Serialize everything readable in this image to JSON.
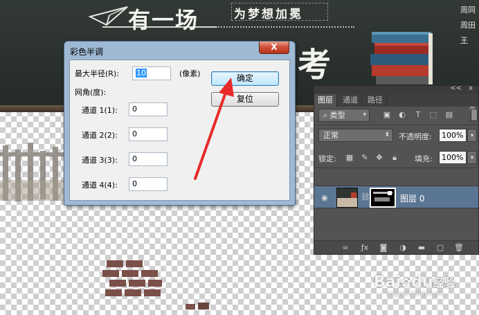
{
  "background": {
    "title_main": "有一场",
    "title_sub": "为梦想加冕",
    "title_big": "考",
    "right_side_text": "周同周田王"
  },
  "dialog": {
    "title": "彩色半调",
    "close_label": "X",
    "max_radius_label": "最大半径(R):",
    "max_radius_value": "10",
    "max_radius_unit": "(像素)",
    "screen_angles_label": "网角(度):",
    "channels": [
      {
        "label": "通道 1(1):",
        "value": "0"
      },
      {
        "label": "通道 2(2):",
        "value": "0"
      },
      {
        "label": "通道 3(3):",
        "value": "0"
      },
      {
        "label": "通道 4(4):",
        "value": "0"
      }
    ],
    "ok_label": "确定",
    "reset_label": "复位"
  },
  "layers_panel": {
    "collapse_label": "<<",
    "close_label": "x",
    "tabs": [
      "图层",
      "通道",
      "路径"
    ],
    "active_tab": "图层",
    "menu_icon": "≡",
    "filter_kind_label": "类型",
    "blend_mode": "正常",
    "opacity_label": "不透明度:",
    "opacity_value": "100%",
    "lock_label": "锁定:",
    "fill_label": "填充:",
    "fill_value": "100%",
    "layer": {
      "name": "图层 0"
    }
  },
  "watermark": {
    "brand": "Bai",
    "brand_tail": "du",
    "cn": "经验",
    "url": "jingyan.baidu.com"
  },
  "colors": {
    "dialog_frame": "#9fb9d4",
    "panel_bg": "#535353",
    "selected_layer": "#5b7693",
    "arrow": "#e82a2a"
  }
}
